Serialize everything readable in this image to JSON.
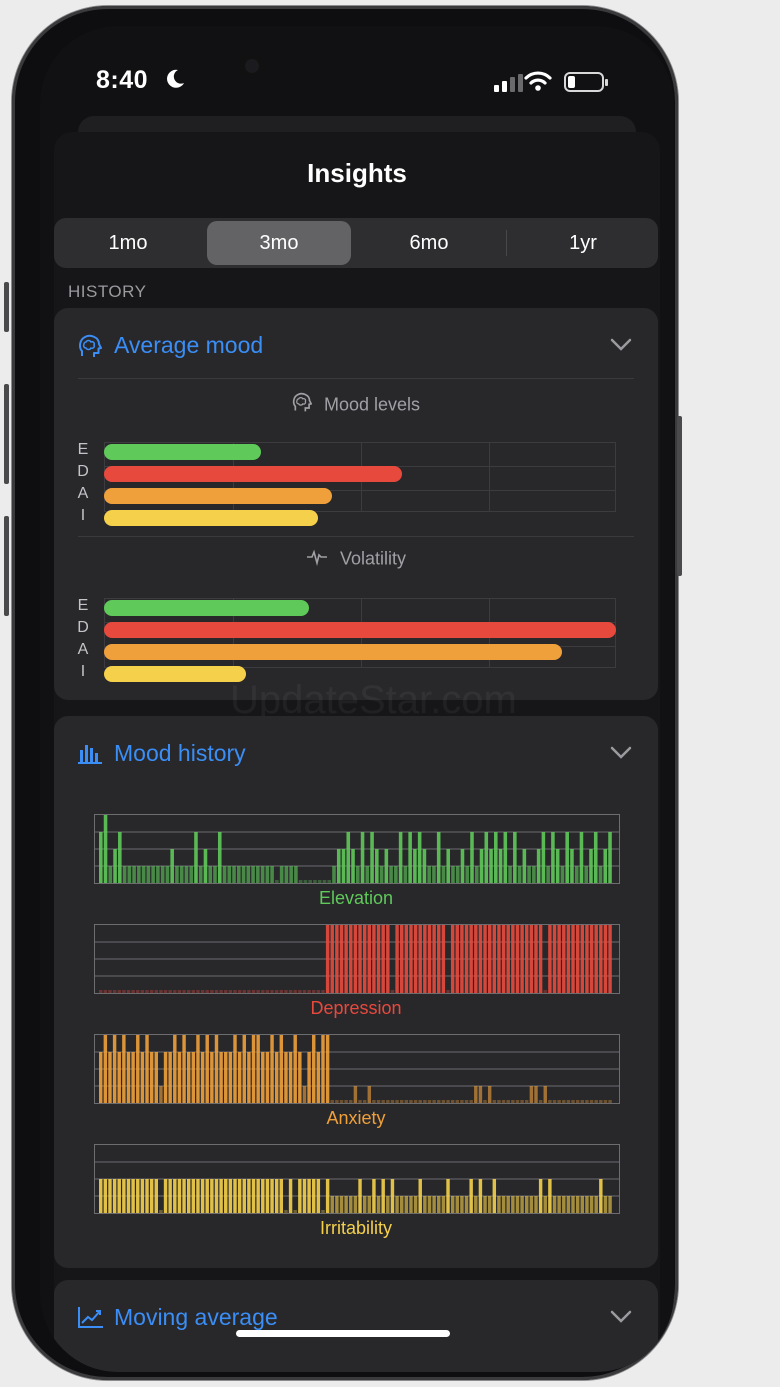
{
  "status": {
    "time": "8:40",
    "moon_icon": "moon-icon",
    "signal_icon": "cellular-signal-icon",
    "wifi_icon": "wifi-icon",
    "battery_icon": "battery-icon"
  },
  "header": {
    "title": "Insights"
  },
  "range_tabs": [
    {
      "label": "1mo",
      "active": false
    },
    {
      "label": "3mo",
      "active": true
    },
    {
      "label": "6mo",
      "active": false
    },
    {
      "label": "1yr",
      "active": false
    }
  ],
  "history_label": "HISTORY",
  "colors": {
    "accent": "#3a8ef6",
    "elevation": "#5fc95a",
    "depression": "#e8493d",
    "anxiety": "#f0a03a",
    "irritability": "#f5d04a"
  },
  "average_mood": {
    "title": "Average mood",
    "icon": "brain-head-icon",
    "mood_levels": {
      "title": "Mood levels",
      "icon": "brain-head-icon",
      "axis_max": 4,
      "rows": [
        {
          "label": "E",
          "value": 1.23,
          "color": "#5fc95a"
        },
        {
          "label": "D",
          "value": 2.33,
          "color": "#e8493d"
        },
        {
          "label": "A",
          "value": 1.78,
          "color": "#f0a03a"
        },
        {
          "label": "I",
          "value": 1.67,
          "color": "#f5d04a"
        }
      ]
    },
    "volatility": {
      "title": "Volatility",
      "icon": "pulse-icon",
      "axis_max": 4,
      "rows": [
        {
          "label": "E",
          "value": 1.6,
          "color": "#5fc95a"
        },
        {
          "label": "D",
          "value": 4.08,
          "color": "#e8493d"
        },
        {
          "label": "A",
          "value": 3.58,
          "color": "#f0a03a"
        },
        {
          "label": "I",
          "value": 1.11,
          "color": "#f5d04a"
        }
      ]
    }
  },
  "mood_history": {
    "title": "Mood history",
    "icon": "bar-chart-icon",
    "charts": [
      {
        "label": "Elevation",
        "color": "#5fc95a",
        "values": [
          3,
          4,
          1,
          2,
          3,
          1,
          1,
          1,
          1,
          1,
          1,
          1,
          1,
          1,
          1,
          2,
          1,
          1,
          1,
          1,
          3,
          1,
          2,
          1,
          1,
          3,
          1,
          1,
          1,
          1,
          1,
          1,
          1,
          1,
          1,
          1,
          1,
          0,
          1,
          1,
          1,
          1,
          0,
          0,
          0,
          0,
          0,
          0,
          0,
          1,
          2,
          2,
          3,
          2,
          1,
          3,
          1,
          3,
          2,
          1,
          2,
          1,
          1,
          3,
          1,
          3,
          2,
          3,
          2,
          1,
          1,
          3,
          1,
          2,
          1,
          1,
          2,
          1,
          3,
          1,
          2,
          3,
          2,
          3,
          2,
          3,
          1,
          3,
          1,
          2,
          1,
          1,
          2,
          3,
          1,
          3,
          2,
          1,
          3,
          2,
          1,
          3,
          1,
          2,
          3,
          1,
          2,
          3
        ]
      },
      {
        "label": "Depression",
        "color": "#e8493d",
        "values": [
          0,
          0,
          0,
          0,
          0,
          0,
          0,
          0,
          0,
          0,
          0,
          0,
          0,
          0,
          0,
          0,
          0,
          0,
          0,
          0,
          0,
          0,
          0,
          0,
          0,
          0,
          0,
          0,
          0,
          0,
          0,
          0,
          0,
          0,
          0,
          0,
          0,
          0,
          0,
          0,
          0,
          0,
          0,
          0,
          0,
          0,
          0,
          0,
          0,
          4,
          4,
          4,
          4,
          4,
          4,
          4,
          4,
          4,
          4,
          4,
          4,
          4,
          4,
          0,
          4,
          4,
          4,
          4,
          4,
          4,
          4,
          4,
          4,
          4,
          4,
          0,
          4,
          4,
          4,
          4,
          4,
          4,
          4,
          4,
          4,
          4,
          4,
          4,
          4,
          4,
          4,
          4,
          4,
          4,
          4,
          4,
          0,
          4,
          4,
          4,
          4,
          4,
          4,
          4,
          4,
          4,
          4,
          4,
          4,
          4,
          4
        ]
      },
      {
        "label": "Anxiety",
        "color": "#f0a03a",
        "values": [
          3,
          4,
          3,
          4,
          3,
          4,
          3,
          3,
          4,
          3,
          4,
          3,
          3,
          1,
          3,
          3,
          4,
          3,
          4,
          3,
          3,
          4,
          3,
          4,
          3,
          4,
          3,
          3,
          3,
          4,
          3,
          4,
          3,
          4,
          4,
          3,
          3,
          4,
          3,
          4,
          3,
          3,
          4,
          3,
          1,
          3,
          4,
          3,
          4,
          4,
          0,
          0,
          0,
          0,
          0,
          1,
          0,
          0,
          1,
          0,
          0,
          0,
          0,
          0,
          0,
          0,
          0,
          0,
          0,
          0,
          0,
          0,
          0,
          0,
          0,
          0,
          0,
          0,
          0,
          0,
          0,
          1,
          1,
          0,
          1,
          0,
          0,
          0,
          0,
          0,
          0,
          0,
          0,
          1,
          1,
          0,
          1,
          0,
          0,
          0,
          0,
          0,
          0,
          0,
          0,
          0,
          0,
          0,
          0,
          0,
          0
        ]
      },
      {
        "label": "Irritability",
        "color": "#f5d04a",
        "values": [
          2,
          2,
          2,
          2,
          2,
          2,
          2,
          2,
          2,
          2,
          2,
          2,
          2,
          0,
          2,
          2,
          2,
          2,
          2,
          2,
          2,
          2,
          2,
          2,
          2,
          2,
          2,
          2,
          2,
          2,
          2,
          2,
          2,
          2,
          2,
          2,
          2,
          2,
          2,
          2,
          0,
          2,
          0,
          2,
          2,
          2,
          2,
          2,
          0,
          2,
          1,
          1,
          1,
          1,
          1,
          1,
          2,
          1,
          1,
          2,
          1,
          2,
          1,
          2,
          1,
          1,
          1,
          1,
          1,
          2,
          1,
          1,
          1,
          1,
          1,
          2,
          1,
          1,
          1,
          1,
          2,
          1,
          2,
          1,
          1,
          2,
          1,
          1,
          1,
          1,
          1,
          1,
          1,
          1,
          1,
          2,
          1,
          2,
          1,
          1,
          1,
          1,
          1,
          1,
          1,
          1,
          1,
          1,
          2,
          1,
          1
        ]
      }
    ]
  },
  "moving_average": {
    "title": "Moving average",
    "icon": "trend-line-icon"
  },
  "watermark": "UpdateStar.com"
}
